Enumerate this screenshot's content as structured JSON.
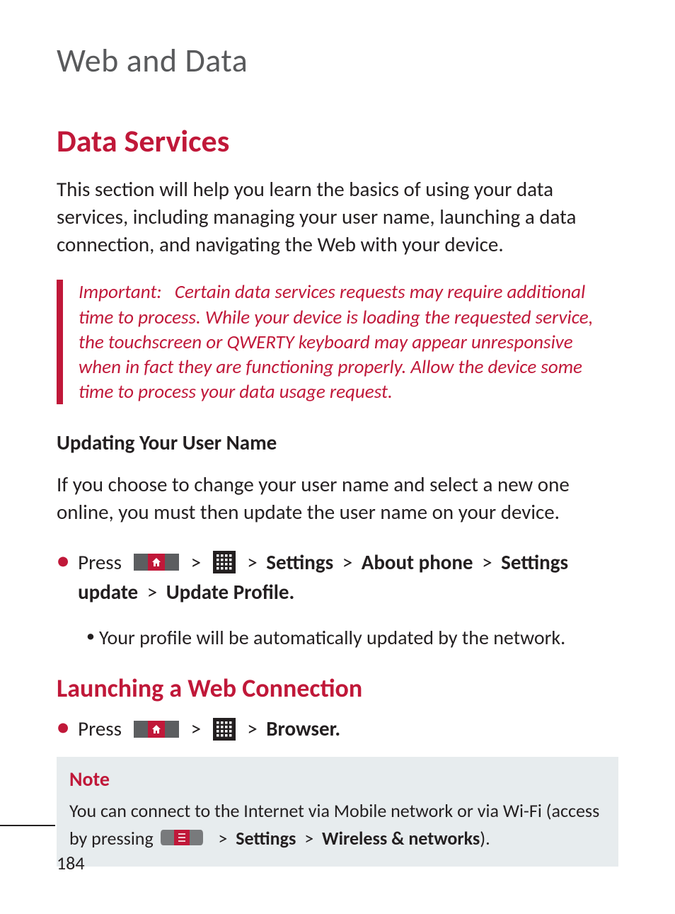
{
  "chapter_title": "Web and Data",
  "h1": "Data Services",
  "intro": "This section will help you learn the basics of using your data services, including managing your user name, launching a data connection, and navigating the Web with your device.",
  "important": {
    "label": "Important:",
    "text": "Certain data services requests may require additional time to process. While your device is loading the requested service, the touchscreen or QWERTY keyboard may appear unresponsive when in fact they are functioning properly. Allow the device some time to process your data usage request."
  },
  "section1": {
    "heading": "Updating Your User Name",
    "body": "If you choose to change your user name and select a new one online, you must then update the user name on your device.",
    "step_press": "Press",
    "path": {
      "p1": "Settings",
      "p2": "About phone",
      "p3": "Settings update",
      "p4": "Update Profile."
    },
    "sub": "Your profile will be automatically updated by the network."
  },
  "section2": {
    "heading": "Launching a Web Connection",
    "step_press": "Press",
    "path": {
      "p1": "Browser."
    }
  },
  "note": {
    "title": "Note",
    "line1": "You can connect to the Internet via Mobile network or via Wi-Fi (access by pressing",
    "path": {
      "p1": "Settings",
      "p2": "Wireless & networks"
    },
    "tail": ")."
  },
  "page_number": "184",
  "sep": ">"
}
